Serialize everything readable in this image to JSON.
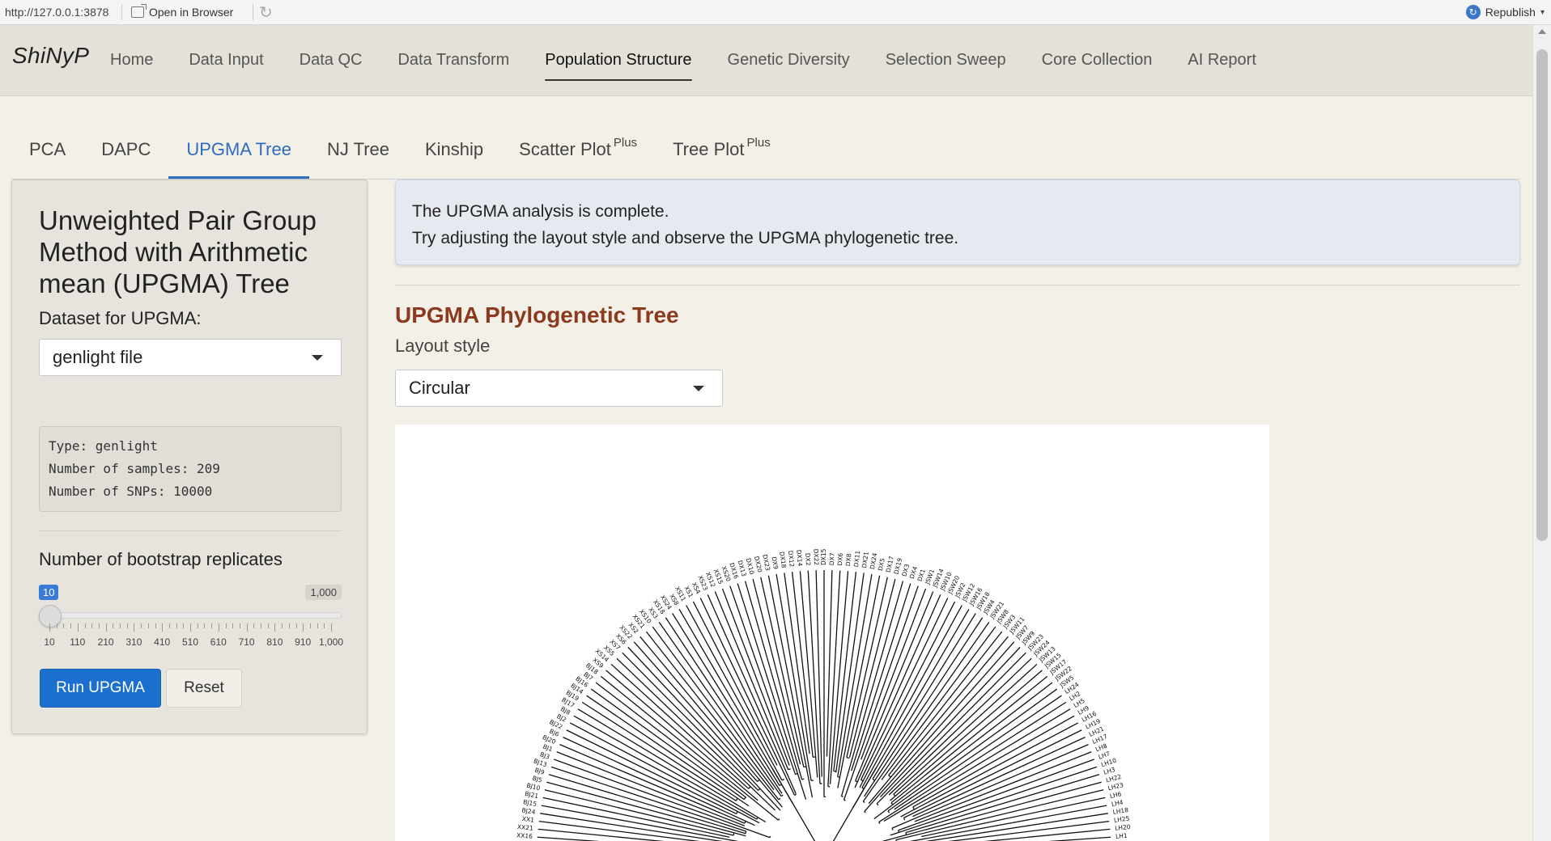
{
  "viewer": {
    "url": "http://127.0.0.1:3878",
    "open_in_browser": "Open in Browser",
    "republish": "Republish"
  },
  "navbar": {
    "brand": "ShiNyP",
    "items": [
      "Home",
      "Data Input",
      "Data QC",
      "Data Transform",
      "Population Structure",
      "Genetic Diversity",
      "Selection Sweep",
      "Core Collection",
      "AI Report"
    ],
    "active": "Population Structure"
  },
  "subtabs": {
    "items": [
      {
        "label": "PCA",
        "sup": ""
      },
      {
        "label": "DAPC",
        "sup": ""
      },
      {
        "label": "UPGMA Tree",
        "sup": ""
      },
      {
        "label": "NJ Tree",
        "sup": ""
      },
      {
        "label": "Kinship",
        "sup": ""
      },
      {
        "label": "Scatter Plot",
        "sup": "Plus"
      },
      {
        "label": "Tree Plot",
        "sup": "Plus"
      }
    ],
    "active": "UPGMA Tree"
  },
  "sidebar": {
    "title": "Unweighted Pair Group Method with Arithmetic mean (UPGMA) Tree",
    "dataset_label": "Dataset for UPGMA:",
    "dataset_value": "genlight file",
    "info_lines": [
      "Type: genlight",
      "Number of samples: 209",
      "Number of SNPs: 10000"
    ],
    "bootstrap_label": "Number of bootstrap replicates",
    "slider": {
      "min": 10,
      "max": 1000,
      "value": 10,
      "value_label": "10",
      "max_label": "1,000",
      "tick_labels": [
        "10",
        "110",
        "210",
        "310",
        "410",
        "510",
        "610",
        "710",
        "810",
        "910",
        "1,000"
      ]
    },
    "run_label": "Run UPGMA",
    "reset_label": "Reset"
  },
  "main": {
    "alert_line1": "The UPGMA analysis is complete.",
    "alert_line2": "Try adjusting the layout style and observe the UPGMA phylogenetic tree.",
    "tree_title": "UPGMA Phylogenetic Tree",
    "layout_label": "Layout style",
    "layout_value": "Circular"
  },
  "tree": {
    "tips": [
      "XX16",
      "XX21",
      "XX1",
      "BJ24",
      "BJ15",
      "BJ21",
      "BJ10",
      "BJ5",
      "BJ9",
      "BJ13",
      "BJ3",
      "BJ1",
      "BJ20",
      "BJ6",
      "BJ22",
      "BJ2",
      "BJ8",
      "BJ17",
      "BJ19",
      "BJ14",
      "BJ16",
      "BJ7",
      "BJ18",
      "XS9",
      "XS14",
      "XS5",
      "XS7",
      "XS6",
      "XS22",
      "XS2",
      "XS21",
      "XS10",
      "XS3",
      "XS18",
      "XS24",
      "XS8",
      "XS11",
      "XS1",
      "XS4",
      "XS23",
      "XS12",
      "XS15",
      "XS20",
      "DX16",
      "DX13",
      "DX10",
      "DX20",
      "DX23",
      "DX9",
      "DX18",
      "DX12",
      "DX14",
      "DX2",
      "DX22",
      "DX15",
      "DX7",
      "DX6",
      "DX8",
      "DX11",
      "DX21",
      "DX24",
      "DX5",
      "DX17",
      "DX19",
      "DX3",
      "DX4",
      "DX1",
      "JSW1",
      "JSW14",
      "JSW10",
      "JSW20",
      "JSW2",
      "JSW12",
      "JSW16",
      "JSW18",
      "JSW4",
      "JSW21",
      "JSW8",
      "JSW3",
      "JSW11",
      "JSW7",
      "JSW9",
      "JSW23",
      "JSW24",
      "JSW13",
      "JSW15",
      "JSW17",
      "JSW22",
      "JSW5",
      "LH24",
      "LH2",
      "LH5",
      "LH9",
      "LH16",
      "LH19",
      "LH21",
      "LH17",
      "LH8",
      "LH7",
      "LH10",
      "LH3",
      "LH22",
      "LH23",
      "LH6",
      "LH4",
      "LH18",
      "LH25",
      "LH20",
      "LH1"
    ]
  }
}
